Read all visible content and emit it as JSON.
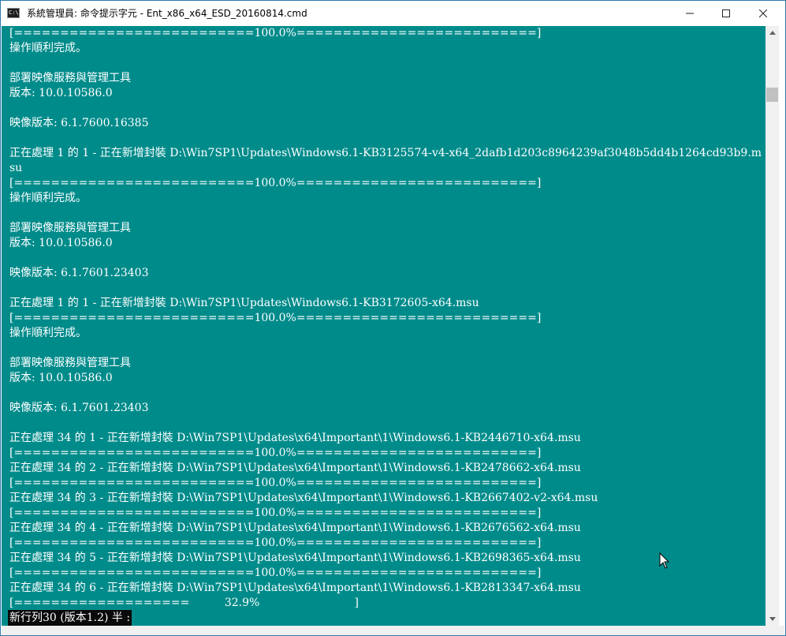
{
  "window": {
    "title": "系統管理員: 命令提示字元 - Ent_x86_x64_ESD_20160814.cmd",
    "icon": "cmd-icon",
    "icon_text": "C:\\",
    "controls": [
      "minimize-icon",
      "maximize-icon",
      "close-icon"
    ]
  },
  "console": {
    "background": "#008b8b",
    "foreground": "#ffffff",
    "lines": [
      "[==========================100.0%==========================]",
      "操作順利完成。",
      "",
      "部署映像服務與管理工具",
      "版本: 10.0.10586.0",
      "",
      "映像版本: 6.1.7600.16385",
      "",
      "正在處理 1 的 1 - 正在新增封裝 D:\\Win7SP1\\Updates\\Windows6.1-KB3125574-v4-x64_2dafb1d203c8964239af3048b5dd4b1264cd93b9.m",
      "su",
      "[==========================100.0%==========================]",
      "操作順利完成。",
      "",
      "部署映像服務與管理工具",
      "版本: 10.0.10586.0",
      "",
      "映像版本: 6.1.7601.23403",
      "",
      "正在處理 1 的 1 - 正在新增封裝 D:\\Win7SP1\\Updates\\Windows6.1-KB3172605-x64.msu",
      "[==========================100.0%==========================]",
      "操作順利完成。",
      "",
      "部署映像服務與管理工具",
      "版本: 10.0.10586.0",
      "",
      "映像版本: 6.1.7601.23403",
      "",
      "正在處理 34 的 1 - 正在新增封裝 D:\\Win7SP1\\Updates\\x64\\Important\\1\\Windows6.1-KB2446710-x64.msu",
      "[==========================100.0%==========================]",
      "正在處理 34 的 2 - 正在新增封裝 D:\\Win7SP1\\Updates\\x64\\Important\\1\\Windows6.1-KB2478662-x64.msu",
      "[==========================100.0%==========================]",
      "正在處理 34 的 3 - 正在新增封裝 D:\\Win7SP1\\Updates\\x64\\Important\\1\\Windows6.1-KB2667402-v2-x64.msu",
      "[==========================100.0%==========================]",
      "正在處理 34 的 4 - 正在新增封裝 D:\\Win7SP1\\Updates\\x64\\Important\\1\\Windows6.1-KB2676562-x64.msu",
      "[==========================100.0%==========================]",
      "正在處理 34 的 5 - 正在新增封裝 D:\\Win7SP1\\Updates\\x64\\Important\\1\\Windows6.1-KB2698365-x64.msu",
      "[==========================100.0%==========================]",
      "正在處理 34 的 6 - 正在新增封裝 D:\\Win7SP1\\Updates\\x64\\Important\\1\\Windows6.1-KB2813347-x64.msu",
      "[===================          32.9%                           ]"
    ],
    "status_line": "新行列30 (版本1.2) 半 :"
  },
  "scrollbar": {
    "up_icon": "scroll-up-arrow-icon",
    "down_icon": "scroll-down-arrow-icon"
  },
  "cursor_icon": "mouse-pointer-icon"
}
